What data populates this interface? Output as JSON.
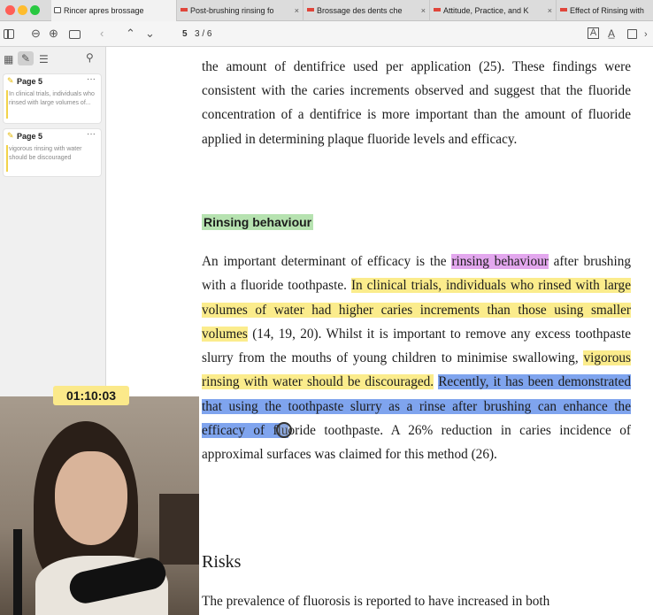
{
  "tabs": [
    {
      "title": "Rincer apres brossage",
      "active": true,
      "icon": "document-icon"
    },
    {
      "title": "Post-brushing rinsing fo",
      "icon": "pdf-icon"
    },
    {
      "title": "Brossage des dents che",
      "icon": "pdf-icon"
    },
    {
      "title": "Attitude, Practice, and K",
      "icon": "pdf-icon"
    },
    {
      "title": "Effect of Rinsing with",
      "icon": "pdf-icon"
    }
  ],
  "tab_close": "×",
  "toolbar": {
    "page_current": "5",
    "page_total": "3 / 6"
  },
  "sidebar": {
    "annotations": [
      {
        "page": "Page 5",
        "text": "In clinical trials, individuals who rinsed with large volumes of...",
        "more": "···"
      },
      {
        "page": "Page 5",
        "text": "vigorous rinsing with water should be discouraged",
        "more": "···"
      }
    ]
  },
  "document": {
    "para1": "the amount of dentifrice used per application (25). These findings were consistent with the caries increments observed and suggest that the fluoride concentration of a dentifrice is more important than the amount of fluoride applied in determining plaque fluoride levels and efficacy.",
    "heading": "Rinsing behaviour",
    "para2_a": "An important determinant of efficacy is the ",
    "para2_pink": "rinsing behaviour",
    "para2_b": " after brushing with a fluoride toothpaste. ",
    "para2_yellow1": "In clinical trials, indi­viduals who rinsed with large volumes of water had higher caries increments than those using smaller volumes",
    "para2_c": " (14, 19, 20). Whilst it is important to remove any excess toothpaste slurry from the mouths of young children to minimise swallowing, ",
    "para2_yellow2": "vigorous rinsing with water should be discouraged.",
    "para2_d": " ",
    "para2_blue": "Recently, it has been demonstrated that using the toothpaste slurry as a rinse after brushing can enhance the efficacy of flu",
    "para2_e": "oride toothpaste. A 26% reduction in caries incidence of approximal surfaces was claimed for this method (26).",
    "risks_heading": "Risks",
    "para3": "The prevalence of fluorosis is reported to have increased in both"
  },
  "overlay": {
    "timer": "01:10:03"
  },
  "colors": {
    "highlight_pink": "#e3a7ee",
    "highlight_yellow": "#fbec8c",
    "highlight_blue": "#7fa4ee",
    "heading_green": "#b6e2b0",
    "timer_bg": "#fbe98a"
  }
}
